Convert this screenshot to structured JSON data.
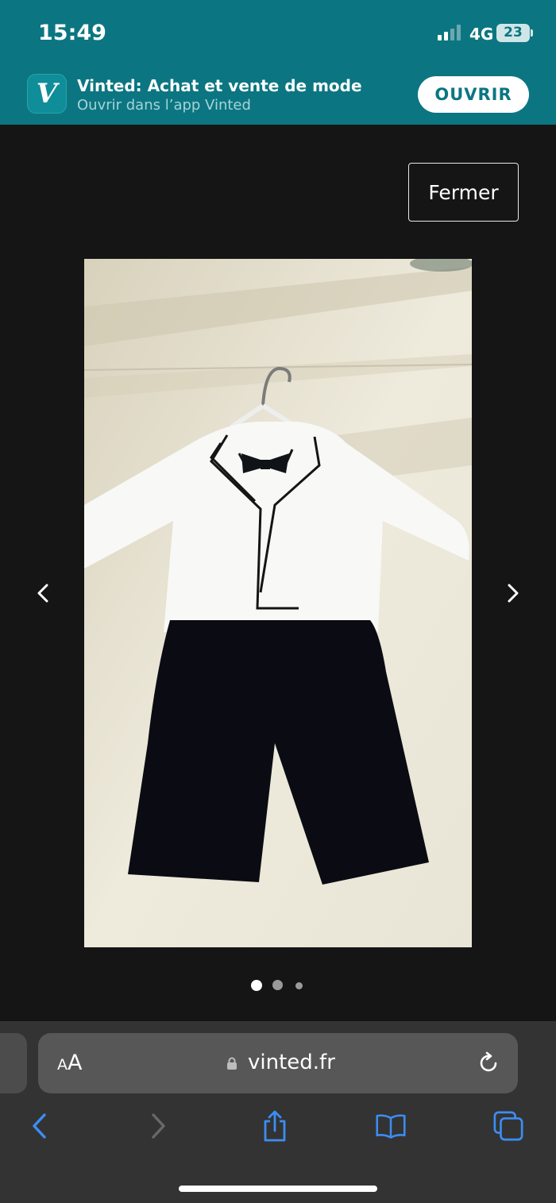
{
  "status_bar": {
    "time": "15:49",
    "network": "4G",
    "battery": "23"
  },
  "app_banner": {
    "icon_letter": "V",
    "title": "Vinted: Achat et vente de mode",
    "subtitle": "Ouvrir dans l’app Vinted",
    "open_label": "OUVRIR"
  },
  "viewer": {
    "close_label": "Fermer",
    "photo_icon": "photo-baby-suit-tshirt-bowtie-trousers",
    "prev_icon": "chevron-left-icon",
    "next_icon": "chevron-right-icon",
    "pagination": {
      "total": 3,
      "active": 1
    }
  },
  "browser": {
    "aa_small": "A",
    "aa_large": "A",
    "url": "vinted.fr",
    "toolbar": [
      "back-icon",
      "forward-icon",
      "share-icon",
      "bookmarks-icon",
      "tabs-icon"
    ]
  },
  "colors": {
    "teal": "#0b7681",
    "viewer_bg": "#151515",
    "toolbar_bg": "#333333",
    "ios_blue": "#3b8ef3"
  }
}
